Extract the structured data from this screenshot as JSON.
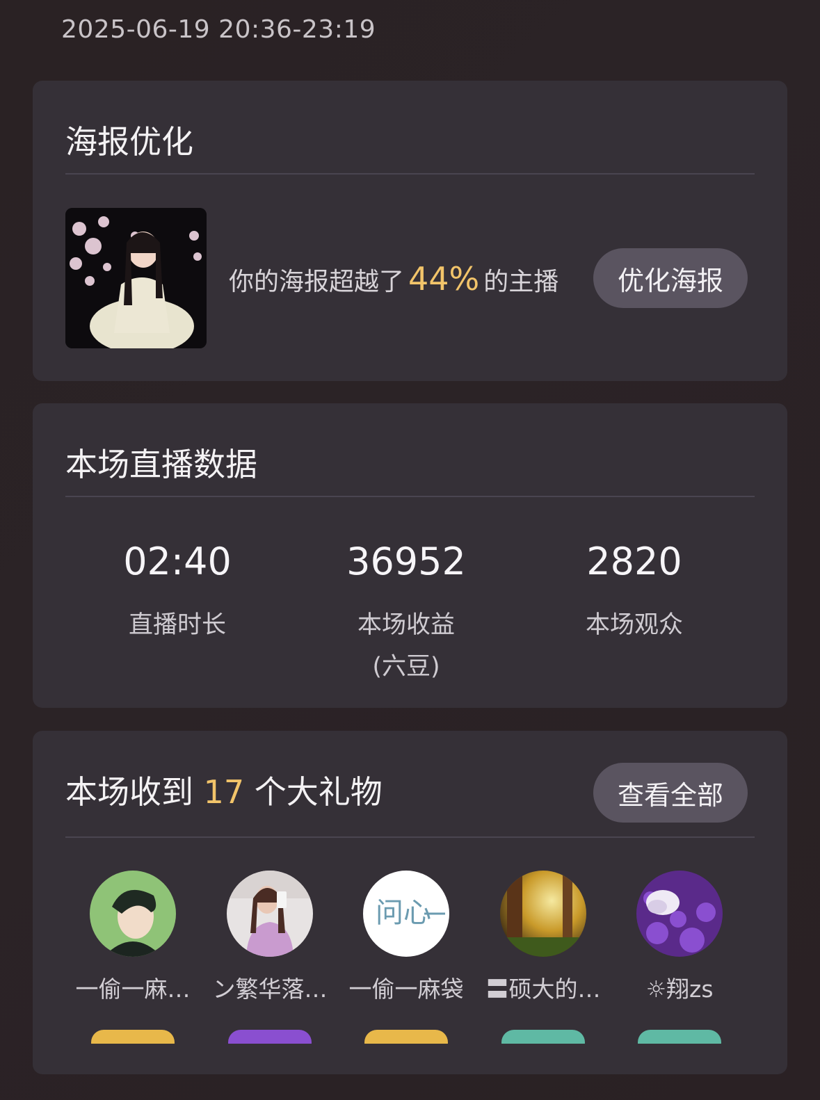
{
  "header": {
    "time_range": "2025-06-19 20:36-23:19"
  },
  "poster": {
    "title": "海报优化",
    "text_before": "你的海报超越了",
    "percent": "44%",
    "text_after": "的主播",
    "button_label": "优化海报"
  },
  "live_data": {
    "title": "本场直播数据",
    "stats": [
      {
        "value": "02:40",
        "label": "直播时长",
        "sublabel": ""
      },
      {
        "value": "36952",
        "label": "本场收益",
        "sublabel": "(六豆)"
      },
      {
        "value": "2820",
        "label": "本场观众",
        "sublabel": ""
      }
    ]
  },
  "gifts": {
    "title_before": "本场收到",
    "count": "17",
    "title_after": "个大礼物",
    "view_all_label": "查看全部",
    "users": [
      {
        "name": "一偷一麻…",
        "avatar": "anime-man-avatar",
        "badge_color": "#e8b84a"
      },
      {
        "name": "ン繁华落…",
        "avatar": "woman-selfie-avatar",
        "badge_color": "#8a4fd0"
      },
      {
        "name": "一偷一麻袋",
        "avatar": "text-logo-avatar",
        "badge_color": "#e8b84a"
      },
      {
        "name": "〓硕大的…",
        "avatar": "forest-avatar",
        "badge_color": "#5fb9a4"
      },
      {
        "name": "☼翔zs",
        "avatar": "purple-flower-avatar",
        "badge_color": "#5fb9a4"
      }
    ]
  }
}
